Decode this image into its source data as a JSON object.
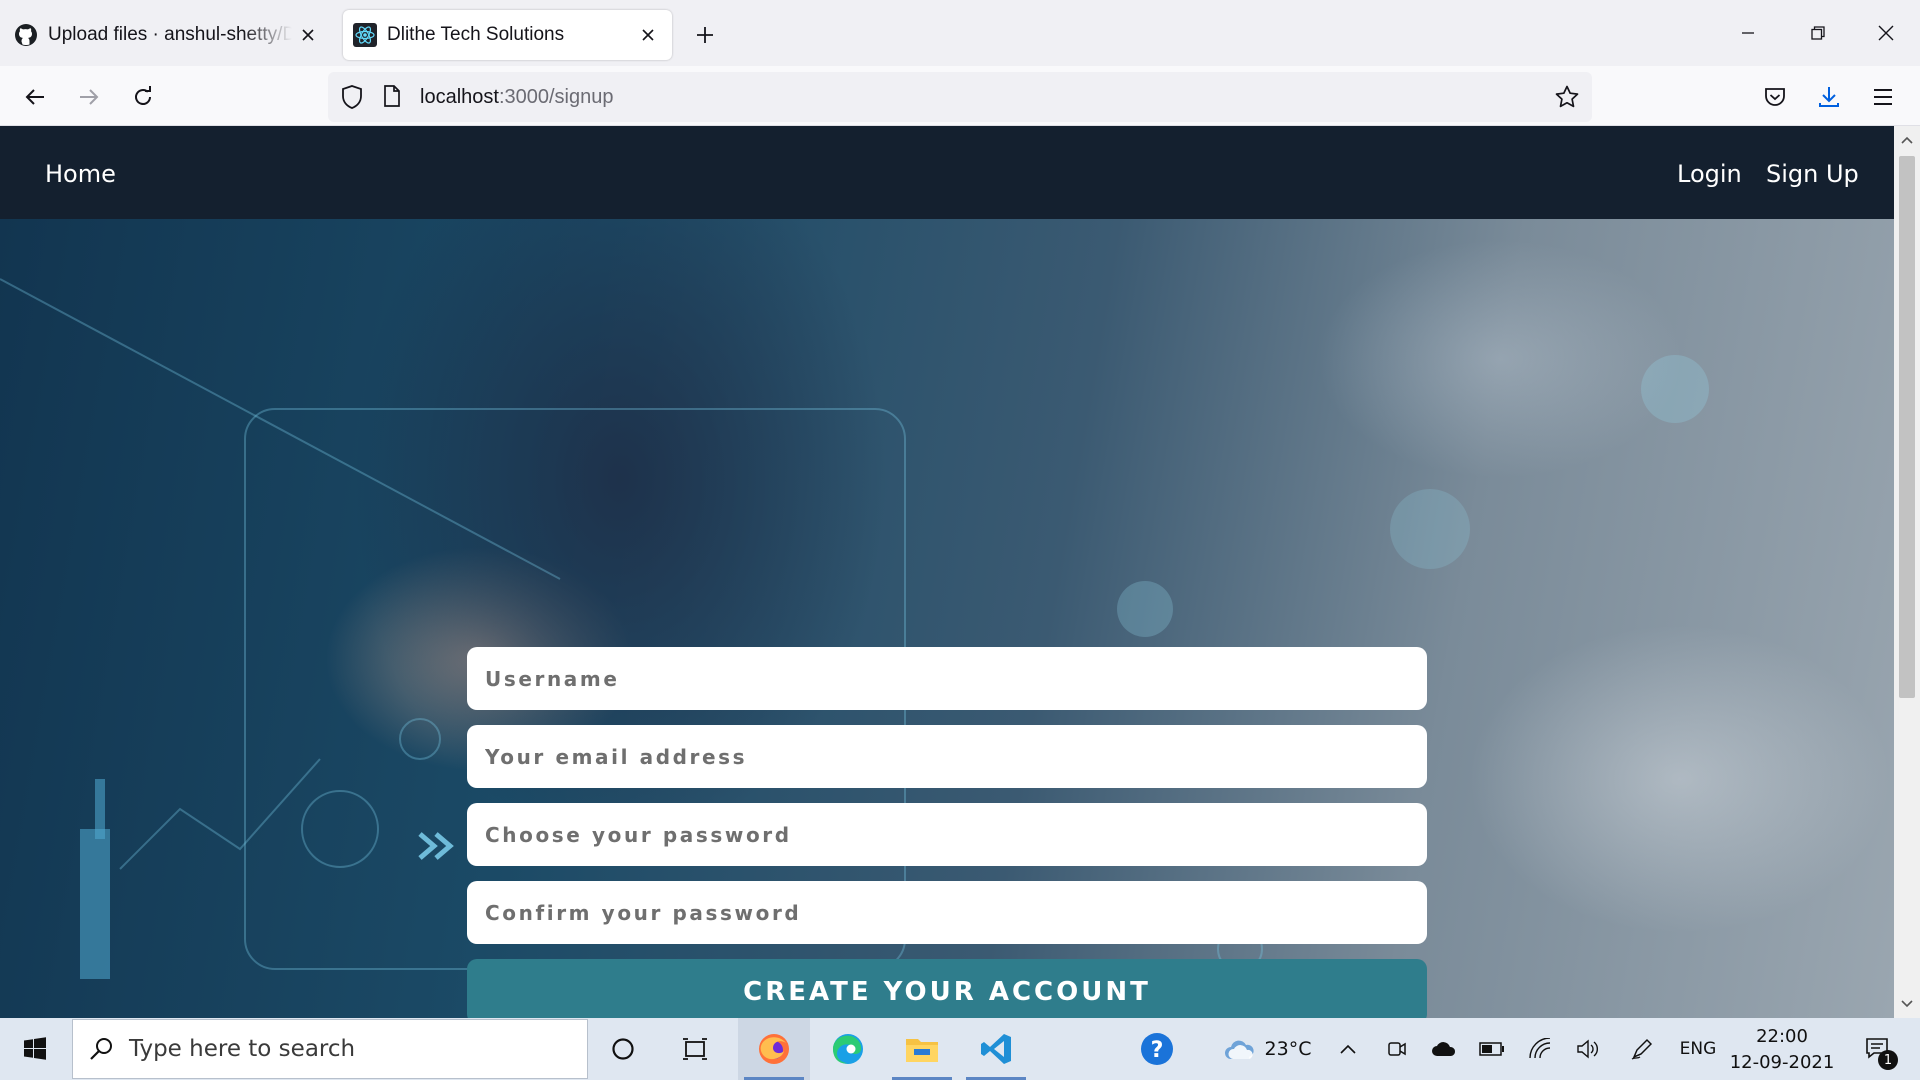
{
  "browser": {
    "tabs": [
      {
        "title": "Upload files · anshul-shetty/Dlit",
        "icon": "github-icon",
        "active": false
      },
      {
        "title": "Dlithe Tech Solutions",
        "icon": "react-icon",
        "active": true
      }
    ],
    "url_host": "localhost",
    "url_path": ":3000/signup"
  },
  "site": {
    "nav": {
      "home": "Home",
      "login": "Login",
      "signup": "Sign Up"
    },
    "form": {
      "username_placeholder": "Username",
      "email_placeholder": "Your email address",
      "password_placeholder": "Choose your password",
      "confirm_placeholder": "Confirm your password",
      "submit_label": "CREATE YOUR ACCOUNT"
    },
    "colors": {
      "nav_bg": "#14202f",
      "button_bg": "#2f7d8c"
    }
  },
  "taskbar": {
    "search_placeholder": "Type here to search",
    "weather": "23°C",
    "language": "ENG",
    "time": "22:00",
    "date": "12-09-2021",
    "notification_count": "1"
  }
}
